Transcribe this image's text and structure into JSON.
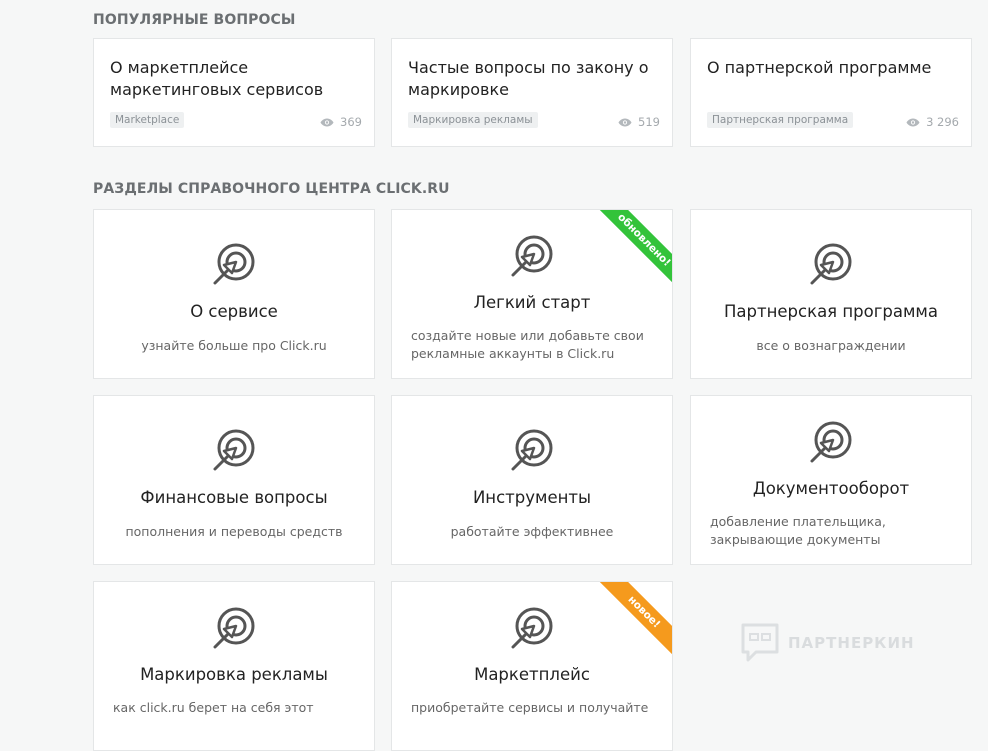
{
  "popular": {
    "title": "ПОПУЛЯРНЫЕ ВОПРОСЫ",
    "questions": [
      {
        "title": "О маркетплейсе маркетинговых сервисов",
        "tag": "Marketplace",
        "views": "369"
      },
      {
        "title": "Частые вопросы по закону о маркировке",
        "tag": "Маркировка рекламы",
        "views": "519"
      },
      {
        "title": "О партнерской программе",
        "tag": "Партнерская программа",
        "views": "3 296"
      }
    ]
  },
  "sections": {
    "title": "РАЗДЕЛЫ СПРАВОЧНОГО ЦЕНТРА CLICK.RU",
    "items": [
      {
        "title": "О сервисе",
        "desc": "узнайте больше про Click.ru",
        "icon": "target-cursor-icon"
      },
      {
        "title": "Легкий старт",
        "desc": "создайте новые или добавьте свои рекламные аккаунты в Click.ru",
        "icon": "target-cursor-icon",
        "ribbon": "обновлено!",
        "ribbon_color": "#33c33a"
      },
      {
        "title": "Партнерская программа",
        "desc": "все о вознаграждении",
        "icon": "target-cursor-icon"
      },
      {
        "title": "Финансовые вопросы",
        "desc": "пополнения и переводы средств",
        "icon": "target-cursor-icon"
      },
      {
        "title": "Инструменты",
        "desc": "работайте эффективнее",
        "icon": "target-cursor-icon"
      },
      {
        "title": "Документооборот",
        "desc": "добавление плательщика, закрывающие документы",
        "icon": "target-cursor-icon"
      },
      {
        "title": "Маркировка рекламы",
        "desc": "как click.ru берет на себя этот",
        "icon": "target-cursor-icon"
      },
      {
        "title": "Маркетплейс",
        "desc": "приобретайте сервисы и получайте",
        "icon": "target-cursor-icon",
        "ribbon": "новое!",
        "ribbon_color": "#f59a1d"
      }
    ]
  },
  "watermark": {
    "text": "ПАРТНЕРКИН"
  }
}
